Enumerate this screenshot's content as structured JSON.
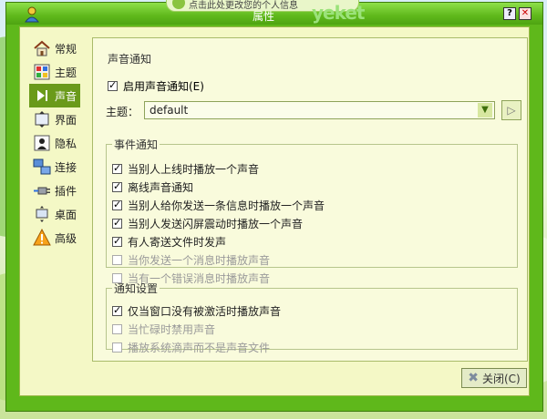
{
  "window": {
    "title": "属性",
    "brand": "yeket",
    "top_notice": "点击此处更改您的个人信息"
  },
  "controls": {
    "help": "?",
    "close": "✕"
  },
  "sidebar": {
    "items": [
      {
        "label": "常规",
        "icon": "house-icon",
        "active": false
      },
      {
        "label": "主题",
        "icon": "palette-icon",
        "active": false
      },
      {
        "label": "声音",
        "icon": "speaker-icon",
        "active": true
      },
      {
        "label": "界面",
        "icon": "window-icon",
        "active": false
      },
      {
        "label": "隐私",
        "icon": "person-icon",
        "active": false
      },
      {
        "label": "连接",
        "icon": "network-icon",
        "active": false
      },
      {
        "label": "插件",
        "icon": "plug-icon",
        "active": false
      },
      {
        "label": "桌面",
        "icon": "desktop-icon",
        "active": false
      },
      {
        "label": "高级",
        "icon": "warning-icon",
        "active": false
      }
    ]
  },
  "panel": {
    "title": "声音通知",
    "enable_label": "启用声音通知(E)",
    "enable_checked": true,
    "theme_label": "主题：",
    "theme_value": "default",
    "event_group": {
      "legend": "事件通知",
      "options": [
        {
          "label": "当别人上线时播放一个声音",
          "checked": true,
          "disabled": false
        },
        {
          "label": "离线声音通知",
          "checked": true,
          "disabled": false
        },
        {
          "label": "当别人给你发送一条信息时播放一个声音",
          "checked": true,
          "disabled": false
        },
        {
          "label": "当别人发送闪屏震动时播放一个声音",
          "checked": true,
          "disabled": false
        },
        {
          "label": "有人寄送文件时发声",
          "checked": true,
          "disabled": false
        },
        {
          "label": "当你发送一个消息时播放声音",
          "checked": false,
          "disabled": true
        },
        {
          "label": "当有一个错误消息时播放声音",
          "checked": false,
          "disabled": true
        }
      ]
    },
    "notice_group": {
      "legend": "通知设置",
      "options": [
        {
          "label": "仅当窗口没有被激活时播放声音",
          "checked": true,
          "disabled": false
        },
        {
          "label": "当忙碌时禁用声音",
          "checked": false,
          "disabled": true
        },
        {
          "label": "播放系统滴声而不是声音文件",
          "checked": false,
          "disabled": true
        }
      ]
    }
  },
  "footer": {
    "close_label": "关闭(C)"
  }
}
